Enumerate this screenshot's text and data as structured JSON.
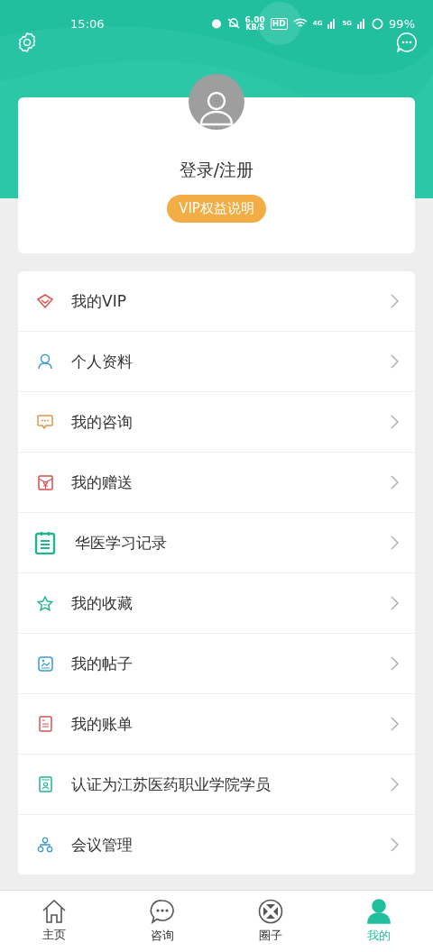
{
  "status_bar": {
    "time": "15:06",
    "speed_value": "6.00",
    "speed_unit": "KB/S",
    "hd": "HD",
    "net_1": "4G",
    "net_2": "5G",
    "battery": "99%"
  },
  "profile": {
    "login_label": "登录/注册",
    "vip_button": "VIP权益说明"
  },
  "menu": [
    {
      "kind": "vip",
      "label": "我的VIP"
    },
    {
      "kind": "person",
      "label": "个人资料"
    },
    {
      "kind": "chat",
      "label": "我的咨询"
    },
    {
      "kind": "gift",
      "label": "我的赠送"
    },
    {
      "kind": "clipboard",
      "label": "华医学习记录"
    },
    {
      "kind": "star",
      "label": "我的收藏"
    },
    {
      "kind": "image",
      "label": "我的帖子"
    },
    {
      "kind": "bill",
      "label": "我的账单"
    },
    {
      "kind": "badge",
      "label": "认证为江苏医药职业学院学员"
    },
    {
      "kind": "org",
      "label": "会议管理"
    }
  ],
  "tabs": [
    {
      "kind": "home",
      "label": "主页",
      "selected": false
    },
    {
      "kind": "chat",
      "label": "咨询",
      "selected": false
    },
    {
      "kind": "circle",
      "label": "圈子",
      "selected": false
    },
    {
      "kind": "me",
      "label": "我的",
      "selected": true
    }
  ]
}
